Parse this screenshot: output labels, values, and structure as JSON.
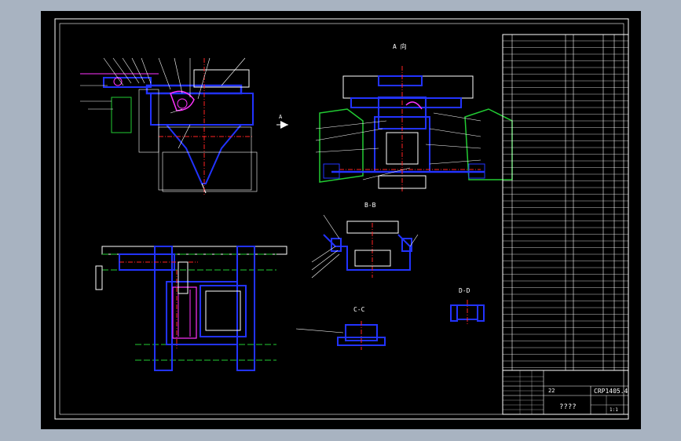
{
  "views": {
    "view_a": "A 向",
    "section_b": "B-B",
    "section_c": "C-C",
    "section_d": "D-D",
    "arrow_a": "A"
  },
  "title_block": {
    "drawing_number": "CRP1405.4",
    "name": "????",
    "scale": "1:1",
    "qty": "22"
  },
  "colors": {
    "sheet": "#000000",
    "frame": "#ffffff",
    "structure": "#2233ff",
    "center_line": "#ff2222",
    "hidden_line": "#22cc33",
    "detail": "#ff33ff",
    "dimension": "#ffffff"
  }
}
